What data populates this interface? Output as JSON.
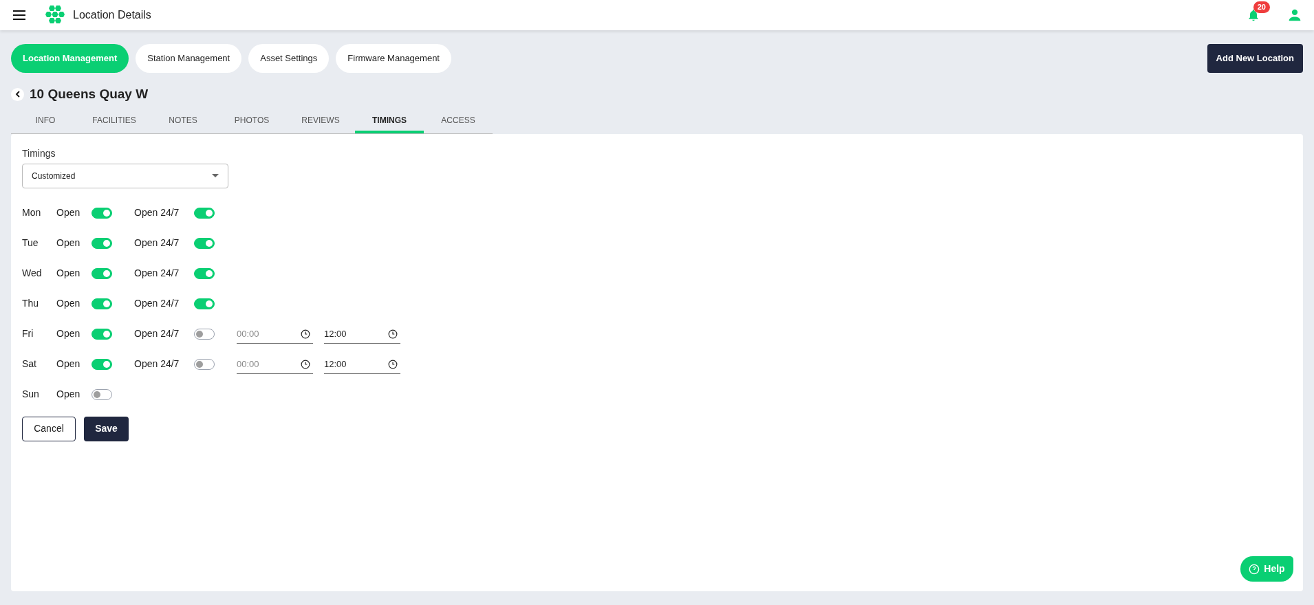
{
  "header": {
    "title": "Location Details",
    "notification_count": "20"
  },
  "nav": [
    {
      "label": "Location Management",
      "selected": true
    },
    {
      "label": "Station Management",
      "selected": false
    },
    {
      "label": "Asset Settings",
      "selected": false
    },
    {
      "label": "Firmware Management",
      "selected": false
    }
  ],
  "add_button": "Add New Location",
  "page_title": "10 Queens Quay W",
  "tabs": [
    {
      "label": "INFO",
      "selected": false
    },
    {
      "label": "FACILITIES",
      "selected": false
    },
    {
      "label": "NOTES",
      "selected": false
    },
    {
      "label": "PHOTOS",
      "selected": false
    },
    {
      "label": "REVIEWS",
      "selected": false
    },
    {
      "label": "TIMINGS",
      "selected": true
    },
    {
      "label": "ACCESS",
      "selected": false
    }
  ],
  "timings": {
    "label": "Timings",
    "value": "Customized"
  },
  "days": [
    {
      "day": "Mon",
      "open_label": "Open",
      "open": true,
      "allday_label": "Open 24/7",
      "allday": true
    },
    {
      "day": "Tue",
      "open_label": "Open",
      "open": true,
      "allday_label": "Open 24/7",
      "allday": true
    },
    {
      "day": "Wed",
      "open_label": "Open",
      "open": true,
      "allday_label": "Open 24/7",
      "allday": true
    },
    {
      "day": "Thu",
      "open_label": "Open",
      "open": true,
      "allday_label": "Open 24/7",
      "allday": true
    },
    {
      "day": "Fri",
      "open_label": "Open",
      "open": true,
      "allday_label": "Open 24/7",
      "allday": false,
      "start": {
        "placeholder": "00:00"
      },
      "end": {
        "value": "12:00"
      }
    },
    {
      "day": "Sat",
      "open_label": "Open",
      "open": true,
      "allday_label": "Open 24/7",
      "allday": false,
      "start": {
        "placeholder": "00:00"
      },
      "end": {
        "value": "12:00"
      }
    },
    {
      "day": "Sun",
      "open_label": "Open",
      "open": false
    }
  ],
  "buttons": {
    "cancel": "Cancel",
    "save": "Save"
  },
  "help": "Help"
}
